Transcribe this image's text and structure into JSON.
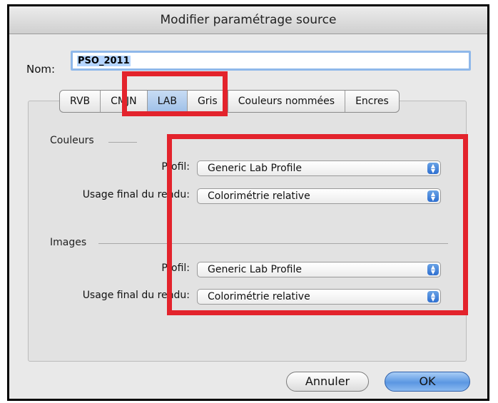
{
  "dialog": {
    "title": "Modifier paramétrage source",
    "name_label": "Nom:",
    "name_value": "PSO_2011"
  },
  "tabs": [
    {
      "label": "RVB",
      "active": false
    },
    {
      "label": "CMJN",
      "active": false
    },
    {
      "label": "LAB",
      "active": true
    },
    {
      "label": "Gris",
      "active": false
    },
    {
      "label": "Couleurs nommées",
      "active": false
    },
    {
      "label": "Encres",
      "active": false
    }
  ],
  "colors_section": {
    "title": "Couleurs",
    "profile_label": "Profil:",
    "profile_value": "Generic Lab Profile",
    "intent_label": "Usage final du rendu:",
    "intent_value": "Colorimétrie relative"
  },
  "images_section": {
    "title": "Images",
    "profile_label": "Profil:",
    "profile_value": "Generic Lab Profile",
    "intent_label": "Usage final du rendu:",
    "intent_value": "Colorimétrie relative"
  },
  "buttons": {
    "cancel": "Annuler",
    "ok": "OK"
  },
  "icons": {
    "popup_arrows": "up-down-arrows-icon"
  },
  "colors": {
    "annotation": "#e3232c",
    "accent": "#5b97e2"
  }
}
